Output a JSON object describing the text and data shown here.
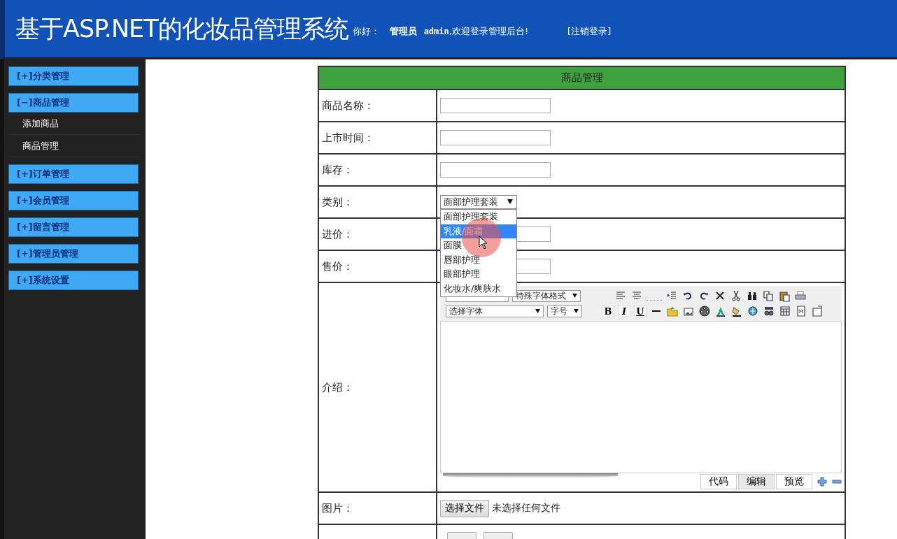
{
  "header": {
    "title": "基于ASP.NET的化妆品管理系统",
    "greeting": "你好：",
    "user_role": "管理员",
    "username": "admin",
    "welcome": ",欢迎登录管理后台!",
    "logout": "[注销登录]"
  },
  "sidebar": {
    "groups": [
      {
        "label": "[+]分类管理"
      },
      {
        "label": "[−]商品管理",
        "children": [
          {
            "label": "添加商品"
          },
          {
            "label": "商品管理"
          }
        ]
      },
      {
        "label": "[+]订单管理"
      },
      {
        "label": "[+]会员管理"
      },
      {
        "label": "[+]留言管理"
      },
      {
        "label": "[+]管理员管理"
      },
      {
        "label": "[+]系统设置"
      }
    ]
  },
  "form": {
    "title": "商品管理",
    "rows": [
      {
        "kind": "text",
        "label": "商品名称："
      },
      {
        "kind": "text",
        "label": "上市时间："
      },
      {
        "kind": "text",
        "label": "库存："
      },
      {
        "kind": "select",
        "label": "类别：",
        "value": "面部护理套装",
        "options": [
          {
            "label": "面部护理套装",
            "highlighted": false
          },
          {
            "label": "乳液/面霜",
            "highlighted": true
          },
          {
            "label": "面膜",
            "highlighted": false
          },
          {
            "label": "唇部护理",
            "highlighted": false
          },
          {
            "label": "眼部护理",
            "highlighted": false
          },
          {
            "label": "化妆水/爽肤水",
            "highlighted": false
          }
        ]
      },
      {
        "kind": "text",
        "label": "进价："
      },
      {
        "kind": "text",
        "label": "售价："
      },
      {
        "kind": "editor",
        "label": "介绍：",
        "selects": [
          "特殊字体格式",
          "选择字体",
          "字号"
        ],
        "format_buttons": [
          "B",
          "I",
          "U"
        ],
        "tabs": [
          {
            "label": "代码",
            "selected": false
          },
          {
            "label": "编辑",
            "selected": true
          },
          {
            "label": "预览",
            "selected": false
          }
        ]
      },
      {
        "kind": "file",
        "label": "图片：",
        "button": "选择文件",
        "status": "未选择任何文件"
      },
      {
        "kind": "buttons",
        "buttons": [
          {
            "kind": "button"
          },
          {
            "kind": "button"
          }
        ]
      }
    ]
  }
}
